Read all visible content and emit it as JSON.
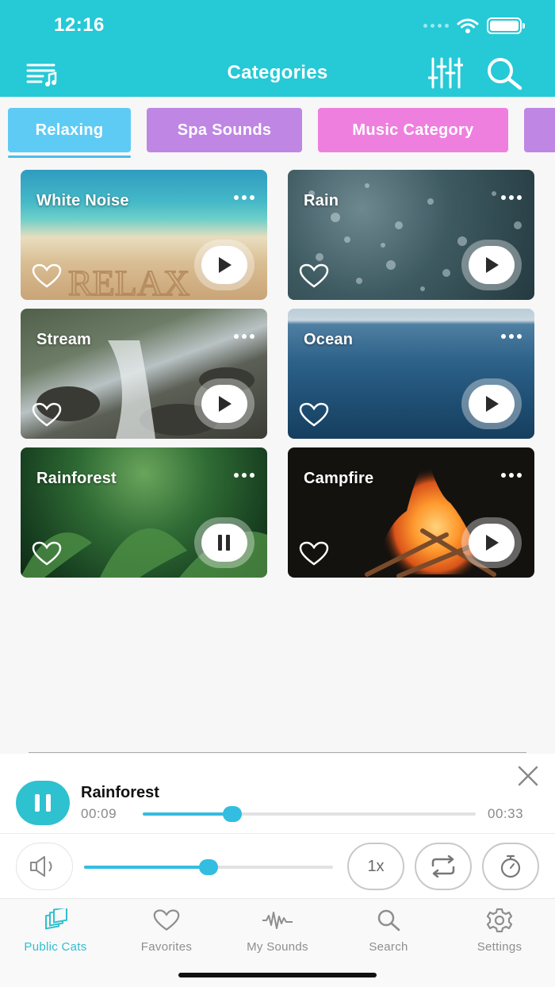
{
  "status_bar": {
    "time": "12:16"
  },
  "header": {
    "title": "Categories",
    "left_icon": "playlist-music-icon",
    "right_icons": [
      "mixer-sliders-icon",
      "search-icon"
    ]
  },
  "category_tabs": [
    {
      "label": "Relaxing",
      "color": "#5ecbf5",
      "selected": true
    },
    {
      "label": "Spa Sounds",
      "color": "#bf86e4"
    },
    {
      "label": "Music Category",
      "color": "#ef7fde"
    }
  ],
  "sounds": [
    {
      "title": "White Noise",
      "state": "play"
    },
    {
      "title": "Rain",
      "state": "play"
    },
    {
      "title": "Stream",
      "state": "play"
    },
    {
      "title": "Ocean",
      "state": "play"
    },
    {
      "title": "Rainforest",
      "state": "pause"
    },
    {
      "title": "Campfire",
      "state": "play"
    }
  ],
  "player": {
    "title": "Rainforest",
    "elapsed": "00:09",
    "total": "00:33",
    "progress_fraction": 0.27,
    "volume_fraction": 0.5,
    "speed_label": "1x"
  },
  "tab_bar": [
    {
      "label": "Public Cats",
      "icon": "layers-icon",
      "active": true
    },
    {
      "label": "Favorites",
      "icon": "heart-icon"
    },
    {
      "label": "My Sounds",
      "icon": "waveform-icon"
    },
    {
      "label": "Search",
      "icon": "search-icon"
    },
    {
      "label": "Settings",
      "icon": "gear-icon"
    }
  ],
  "colors": {
    "accent": "#26c9d6",
    "slider": "#33bde0"
  }
}
